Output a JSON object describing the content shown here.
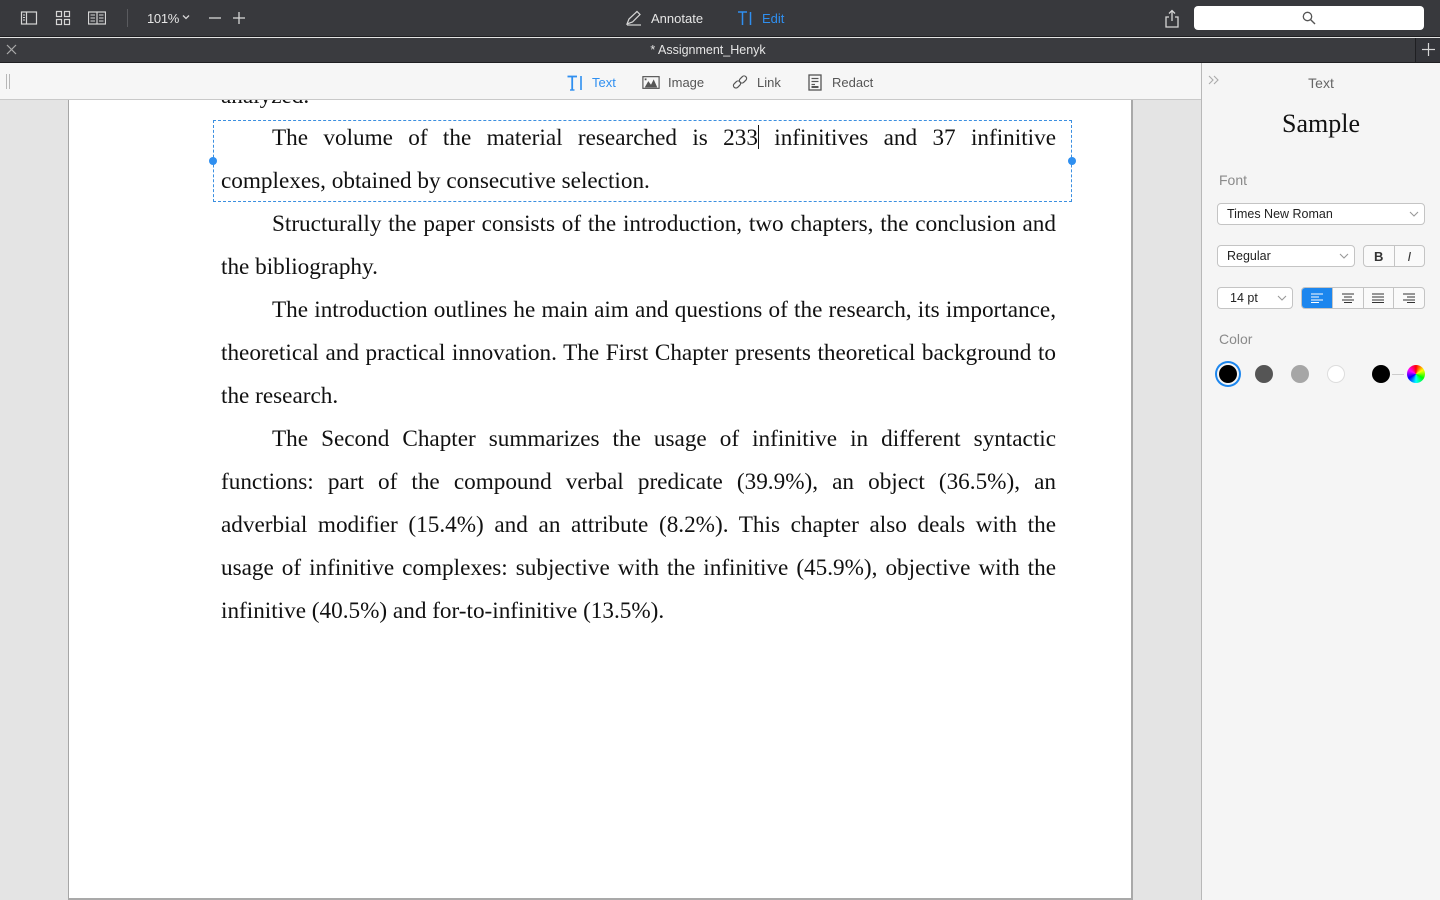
{
  "toolbar": {
    "zoom_level": "101%",
    "annotate_label": "Annotate",
    "edit_label": "Edit",
    "search_placeholder": ""
  },
  "tab": {
    "title": "* Assignment_Henyk"
  },
  "edit_tools": {
    "text_label": "Text",
    "image_label": "Image",
    "link_label": "Link",
    "redact_label": "Redact"
  },
  "document": {
    "cut_line": "analyzed.",
    "selected_before_caret": "The volume of the material researched is 233",
    "selected_after_caret": " infinitives and 37 infinitive complexes, obtained by consecutive selection.",
    "paragraphs": [
      "Structurally the paper consists of the introduction, two chapters, the conclusion and the bibliography.",
      " The introduction outlines he main aim and questions of the research, its importance, theoretical and practical innovation. The First Chapter presents theoretical background to the research.",
      "The Second Chapter summarizes the usage of infinitive in different syntactic functions: part of the compound verbal predicate (39.9%), an object (36.5%), an adverbial modifier (15.4%) and an attribute (8.2%). This chapter also deals with the usage of infinitive complexes: subjective with the infinitive (45.9%), objective with the infinitive (40.5%) and for-to-infinitive (13.5%)."
    ]
  },
  "panel": {
    "title": "Text",
    "sample": "Sample",
    "font_label": "Font",
    "font_family": "Times New Roman",
    "font_style": "Regular",
    "bold_label": "B",
    "italic_label": "I",
    "font_size": "14 pt",
    "alignment": "left",
    "color_label": "Color",
    "colors": [
      "#000000",
      "#555555",
      "#a6a6a6",
      "#ffffff"
    ],
    "selected_color": "#000000",
    "current_color": "#000000"
  }
}
